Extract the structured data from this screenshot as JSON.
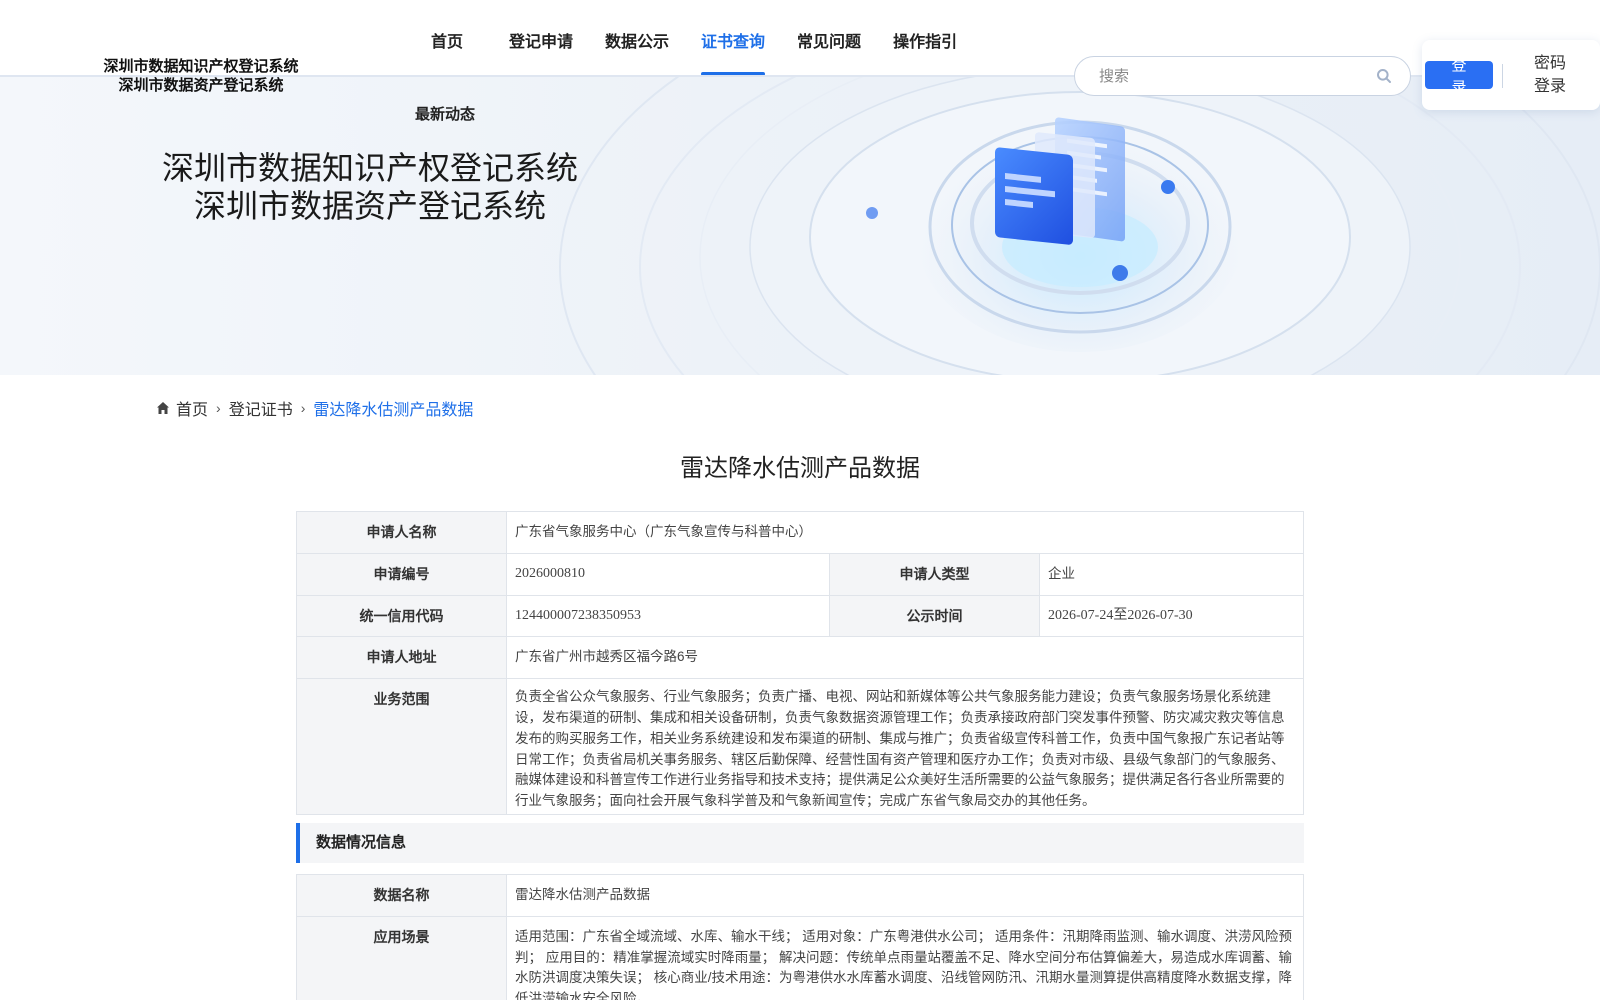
{
  "header": {
    "logo_line1": "深圳市数据知识产权登记系统",
    "logo_line2": "深圳市数据资产登记系统",
    "nav": [
      {
        "label": "首页"
      },
      {
        "label": "登记申请"
      },
      {
        "label": "数据公示"
      },
      {
        "label": "证书查询",
        "active": true
      },
      {
        "label": "常见问题"
      },
      {
        "label": "操作指引"
      }
    ],
    "news_label": "最新动态",
    "search_placeholder": "搜索",
    "login_label": "登录",
    "password_login_label": "密码登录",
    "accent_color": "#1e6fe8"
  },
  "banner": {
    "title_line1": "深圳市数据知识产权登记系统",
    "title_line2": "深圳市数据资产登记系统"
  },
  "breadcrumb": {
    "home": "首页",
    "parent": "登记证书",
    "current": "雷达降水估测产品数据"
  },
  "main": {
    "title": "雷达降水估测产品数据",
    "applicant": {
      "name_label": "申请人名称",
      "name": "广东省气象服务中心（广东气象宣传与科普中心）",
      "number_label": "申请编号",
      "number": "2026000810",
      "type_label": "申请人类型",
      "type": "企业",
      "credit_code_label": "统一信用代码",
      "credit_code": "124400007238350953",
      "publish_time_label": "公示时间",
      "publish_time": "2026-07-24至2026-07-30",
      "address_label": "申请人地址",
      "address": "广东省广州市越秀区福今路6号",
      "scope_label": "业务范围",
      "scope": "负责全省公众气象服务、行业气象服务；负责广播、电视、网站和新媒体等公共气象服务能力建设；负责气象服务场景化系统建设，发布渠道的研制、集成和相关设备研制，负责气象数据资源管理工作；负责承接政府部门突发事件预警、防灾减灾救灾等信息发布的购买服务工作，相关业务系统建设和发布渠道的研制、集成与推广；负责省级宣传科普工作，负责中国气象报广东记者站等日常工作；负责省局机关事务服务、辖区后勤保障、经营性国有资产管理和医疗办工作；负责对市级、县级气象部门的气象服务、融媒体建设和科普宣传工作进行业务指导和技术支持；提供满足公众美好生活所需要的公益气象服务；提供满足各行各业所需要的行业气象服务；面向社会开展气象科学普及和气象新闻宣传；完成广东省气象局交办的其他任务。"
    },
    "data_section_title": "数据情况信息",
    "data_info": {
      "data_name_label": "数据名称",
      "data_name": "雷达降水估测产品数据",
      "scenario_label": "应用场景",
      "scenario": "适用范围：广东省全域流域、水库、输水干线； 适用对象：广东粤港供水公司； 适用条件：汛期降雨监测、输水调度、洪涝风险预判； 应用目的：精准掌握流域实时降雨量； 解决问题：传统单点雨量站覆盖不足、降水空间分布估算偏差大，易造成水库调蓄、输水防洪调度决策失误； 核心商业/技术用途：为粤港供水水库蓄水调度、沿线管网防汛、汛期水量测算提供高精度降水数据支撑，降低洪涝输水安全风险。"
    }
  }
}
